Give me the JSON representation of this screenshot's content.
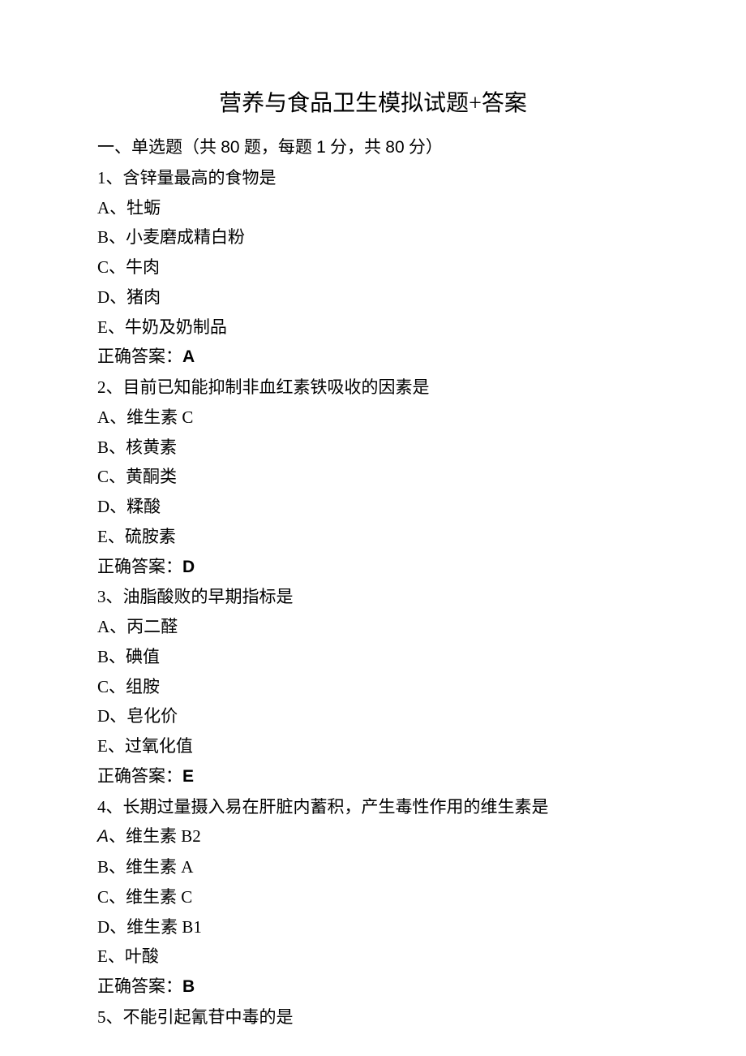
{
  "title": "营养与食品卫生模拟试题+答案",
  "section_header_prefix": "一、单选题（共 ",
  "section_total": "80",
  "section_mid": " 题，每题 ",
  "section_per": "1",
  "section_mid2": " 分，共 ",
  "section_total_score": "80",
  "section_suffix": " 分）",
  "answer_prefix": "正确答案：",
  "questions": [
    {
      "num": "1",
      "stem": "、含锌量最高的食物是",
      "options": {
        "A": "、牡蛎",
        "B": "、小麦磨成精白粉",
        "C": "、牛肉",
        "D": "、猪肉",
        "E": "、牛奶及奶制品"
      },
      "answer": "A"
    },
    {
      "num": "2",
      "stem": "、目前已知能抑制非血红素铁吸收的因素是",
      "options": {
        "A": "、维生素 C",
        "B": "、核黄素",
        "C": "、黄酮类",
        "D": "、糅酸",
        "E": "、硫胺素"
      },
      "answer": "D"
    },
    {
      "num": "3",
      "stem": "、油脂酸败的早期指标是",
      "options": {
        "A": "、丙二醛",
        "B": "、碘值",
        "C": "、组胺",
        "D": "、皂化价",
        "E": "、过氧化值"
      },
      "answer": "E"
    },
    {
      "num": "4",
      "stem": "、长期过量摄入易在肝脏内蓄积，产生毒性作用的维生素是",
      "options": {
        "A": "、维生素 B2",
        "B": "、维生素 A",
        "C": "、维生素 C",
        "D": "、维生素 B1",
        "E": "、叶酸"
      },
      "answer": "B",
      "italic_a": true
    },
    {
      "num": "5",
      "stem": "、不能引起氰苷中毒的是"
    }
  ]
}
